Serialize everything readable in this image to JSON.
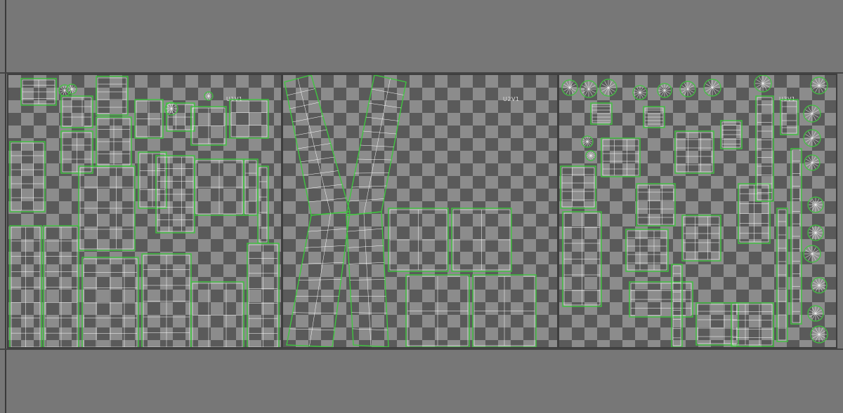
{
  "viewport": {
    "background": "#777777",
    "checker_light": "#8c8c8c",
    "checker_dark": "#5a5a5a",
    "uv_edge_color": "#3fc63f",
    "uv_wire_color": "#ffffff"
  },
  "tiles": [
    {
      "id": "tile-1",
      "label": "U1V1"
    },
    {
      "id": "tile-2",
      "label": "U2V1"
    },
    {
      "id": "tile-3",
      "label": "U3V1"
    }
  ]
}
